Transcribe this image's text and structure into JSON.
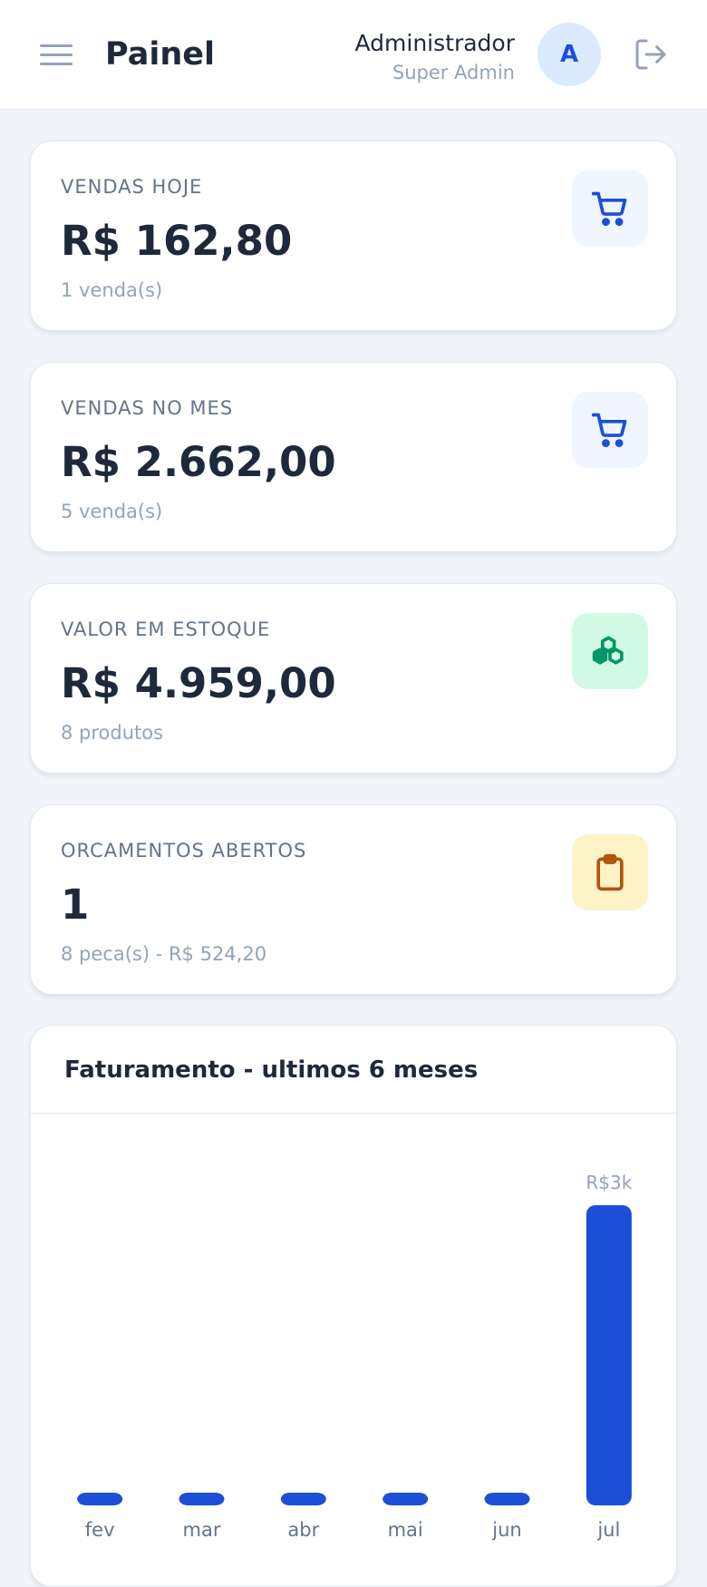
{
  "header": {
    "title": "Painel",
    "user_name": "Administrador",
    "user_role": "Super Admin",
    "avatar_initial": "A",
    "menu_icon": "hamburger-menu-icon",
    "logout_icon": "logout-icon"
  },
  "colors": {
    "accent": "#1d4ed8",
    "bar": "#1d4ed8",
    "text_primary": "#1e293b",
    "text_muted": "#94a3b8",
    "label": "#64748b",
    "icon_bg_blue": "#eff6ff",
    "icon_bg_green": "#d1fae5",
    "icon_bg_yellow": "#fef3c7"
  },
  "cards": [
    {
      "label": "VENDAS HOJE",
      "value": "R$ 162,80",
      "sub": "1 venda(s)",
      "icon": "cart-icon"
    },
    {
      "label": "VENDAS NO MES",
      "value": "R$ 2.662,00",
      "sub": "5 venda(s)",
      "icon": "cart-icon"
    },
    {
      "label": "VALOR EM ESTOQUE",
      "value": "R$ 4.959,00",
      "sub": "8 produtos",
      "icon": "boxes-icon"
    },
    {
      "label": "ORCAMENTOS ABERTOS",
      "value": "1",
      "sub": "8 peca(s) - R$ 524,20",
      "icon": "clipboard-icon"
    }
  ],
  "chart": {
    "title": "Faturamento - ultimos 6 meses"
  },
  "chart_data": {
    "type": "bar",
    "categories": [
      "fev",
      "mar",
      "abr",
      "mai",
      "jun",
      "jul"
    ],
    "values": [
      0,
      0,
      0,
      0,
      0,
      2662
    ],
    "value_labels": [
      "",
      "",
      "",
      "",
      "",
      "R$3k"
    ],
    "ylim": [
      0,
      2662
    ],
    "grid": false,
    "title": "Faturamento - ultimos 6 meses"
  }
}
